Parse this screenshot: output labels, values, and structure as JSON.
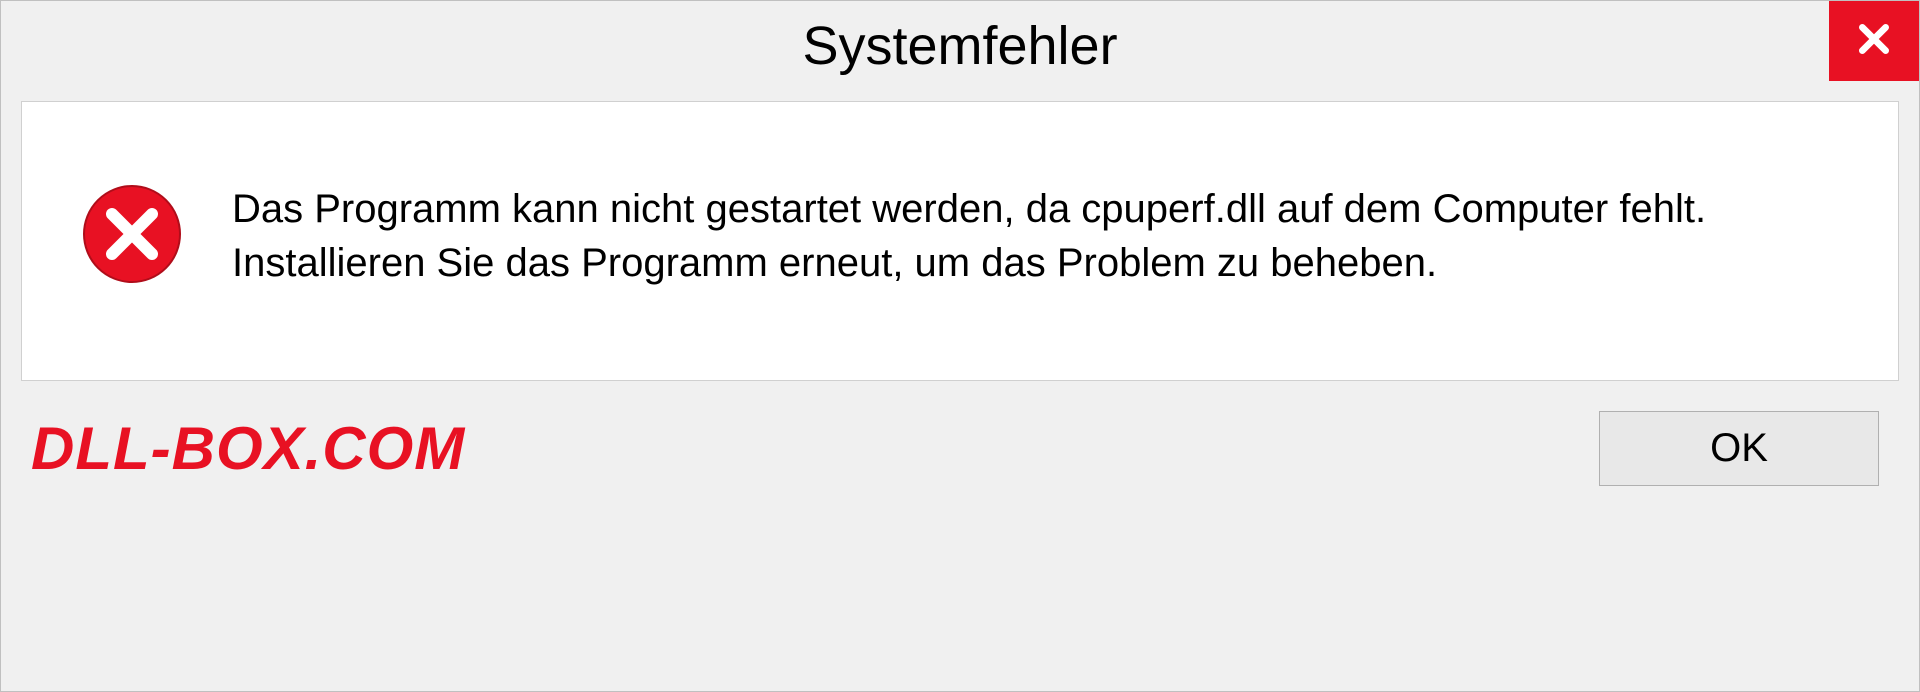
{
  "titlebar": {
    "title": "Systemfehler"
  },
  "content": {
    "message": "Das Programm kann nicht gestartet werden, da cpuperf.dll auf dem Computer fehlt. Installieren Sie das Programm erneut, um das Problem zu beheben."
  },
  "footer": {
    "watermark": "DLL-BOX.COM",
    "ok_label": "OK"
  },
  "colors": {
    "close_button_bg": "#e81123",
    "error_icon_color": "#e81123",
    "watermark_color": "#e81123"
  }
}
